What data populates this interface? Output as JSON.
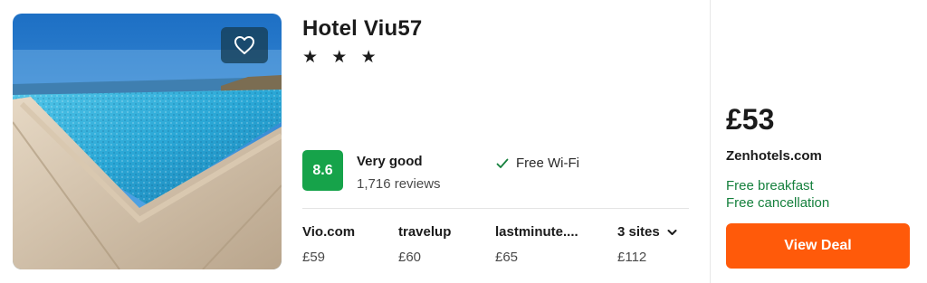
{
  "hotel": {
    "name": "Hotel Viu57",
    "stars": "★ ★ ★",
    "image_alt": "rooftop pool",
    "favorite_icon": "heart-outline-icon"
  },
  "rating": {
    "score": "8.6",
    "label": "Very good",
    "reviews": "1,716 reviews",
    "badge_color": "#16a34a"
  },
  "amenities": [
    {
      "icon": "check-icon",
      "label": "Free Wi-Fi"
    }
  ],
  "providers": [
    {
      "name": "Vio.com",
      "price": "£59"
    },
    {
      "name": "travelup",
      "price": "£60"
    },
    {
      "name": "lastminute....",
      "price": "£65"
    },
    {
      "name": "3 sites",
      "price": "£112",
      "icon": "chevron-down-icon"
    }
  ],
  "deal": {
    "price": "£53",
    "site": "Zenhotels.com",
    "perks": [
      "Free breakfast",
      "Free cancellation"
    ],
    "cta": "View Deal",
    "cta_color": "#ff5a0a",
    "perk_color": "#15803d"
  }
}
